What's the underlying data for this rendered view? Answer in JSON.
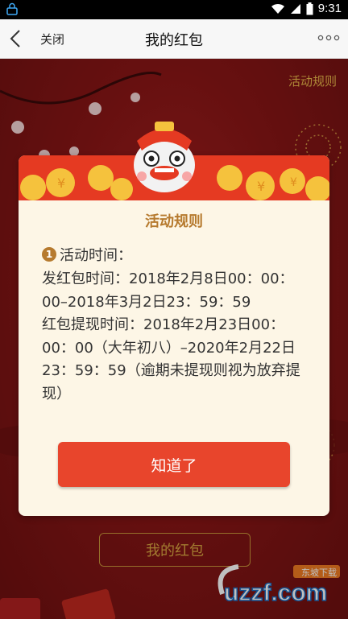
{
  "status_bar": {
    "time": "9:31",
    "icons": [
      "lock-icon",
      "wifi-icon",
      "signal-icon",
      "battery-icon"
    ]
  },
  "nav": {
    "close_label": "关闭",
    "title": "我的红包",
    "more_icon": "more-dots-icon",
    "back_icon": "back-arrow-icon"
  },
  "background": {
    "rules_link": "活动规则",
    "my_redpacket_button": "我的红包"
  },
  "modal": {
    "title": "活动规则",
    "rule_number": "1",
    "rule_heading": "活动时间：",
    "rule_body": "发红包时间：2018年2月8日00：00：00–2018年3月2日23：59：59\n红包提现时间：2018年2月23日00：00：00（大年初八）–2020年2月22日23：59：59（逾期未提现则视为放弃提现）",
    "ok_button": "知道了"
  },
  "watermark": {
    "text": "uzzf.com",
    "badge": "东坡下载"
  },
  "colors": {
    "accent_red": "#e8452c",
    "gold": "#b67a2e",
    "modal_bg": "#fdf6e6",
    "page_bg": "#8a1616"
  }
}
